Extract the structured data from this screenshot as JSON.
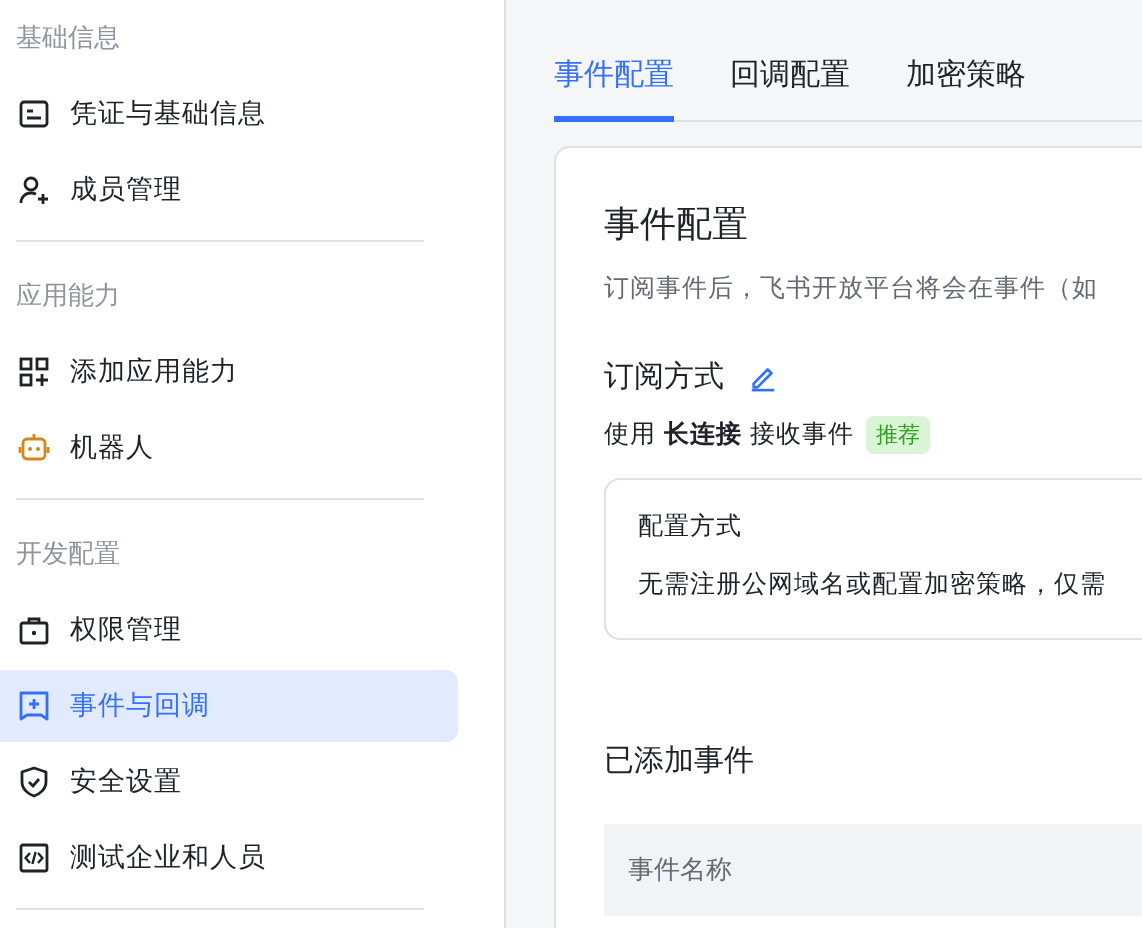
{
  "sidebar": {
    "sections": [
      {
        "title": "基础信息",
        "items": [
          {
            "label": "凭证与基础信息",
            "selected": false
          },
          {
            "label": "成员管理",
            "selected": false
          }
        ]
      },
      {
        "title": "应用能力",
        "items": [
          {
            "label": "添加应用能力",
            "selected": false
          },
          {
            "label": "机器人",
            "selected": false
          }
        ]
      },
      {
        "title": "开发配置",
        "items": [
          {
            "label": "权限管理",
            "selected": false
          },
          {
            "label": "事件与回调",
            "selected": true
          },
          {
            "label": "安全设置",
            "selected": false
          },
          {
            "label": "测试企业和人员",
            "selected": false
          }
        ]
      }
    ]
  },
  "tabs": [
    {
      "label": "事件配置",
      "selected": true
    },
    {
      "label": "回调配置",
      "selected": false
    },
    {
      "label": "加密策略",
      "selected": false
    }
  ],
  "card": {
    "title": "事件配置",
    "description": "订阅事件后，飞书开放平台将会在事件（如",
    "subscription": {
      "title": "订阅方式",
      "line": "使用 **长连接** 接收事件",
      "badge": "推荐"
    },
    "config_box": {
      "title": "配置方式",
      "text": "无需注册公网域名或配置加密策略，仅需"
    },
    "events": {
      "title": "已添加事件",
      "columns": [
        "事件名称"
      ]
    }
  }
}
